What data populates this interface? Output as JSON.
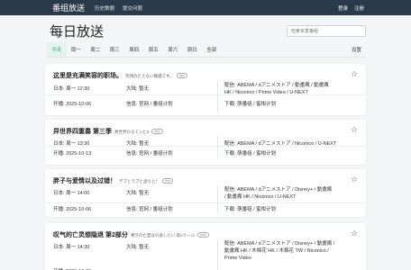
{
  "navbar": {
    "brand": "番组放送",
    "links": [
      "历史数据",
      "提交问题"
    ],
    "login": "登录",
    "register": "注册"
  },
  "page": {
    "title": "每日放送"
  },
  "search": {
    "placeholder": "检索本季番组"
  },
  "tabs": [
    "今天",
    "周一",
    "周二",
    "周三",
    "周四",
    "周五",
    "周六",
    "周日",
    "全部"
  ],
  "active_tab": "今天",
  "settings_label": "设置",
  "labels": {
    "japan": "日本:",
    "mainland": "大陆:",
    "premiere": "开播:",
    "info": "信息:",
    "streaming": "配信:",
    "download": "下载:"
  },
  "cards": [
    {
      "title": "这里是充满笑容的职场。",
      "jp_title": "笑顔のたえない職場です。",
      "badge": "new",
      "japan": "周一 12:30",
      "mainland": "暂无",
      "premiere": "2025-10-06",
      "info": "官网 / 番组计划",
      "streaming": "ABEMA / dアニメストア / 動畫瘋 / 動畫瘋 HK / Niconico / Prime Video / U-NEXT",
      "download": "萌番组 / 蜜柑计划"
    },
    {
      "title": "异世界四重奏 第三季",
      "jp_title": "異世界かるてっと3",
      "badge": "new",
      "japan": "周一 13:30",
      "mainland": "暂无",
      "premiere": "2025-10-13",
      "info": "官网 / 番组计划",
      "streaming": "ABEMA / dアニメストア / Niconico / U-NEXT",
      "download": "萌番组 / 蜜柑计划"
    },
    {
      "title": "胖子与爱情以及过错！",
      "jp_title": "デブとラブと過ちと！",
      "badge": "new",
      "japan": "周一 14:00",
      "mainland": "暂无",
      "premiere": "2025-10-06",
      "info": "官网 / 番组计划",
      "streaming": "ABEMA / dアニメストア / Disney+ / 動畫瘋 / 動畫瘋 HK / Niconico / U-NEXT",
      "download": "萌番组 / 蜜柑计划"
    },
    {
      "title": "叹气的亡灵想隐退 第2部分",
      "jp_title": "嘆きの亡霊は引退したい 第2クール",
      "badge": "new",
      "japan": "周一 14:30",
      "mainland": "暂无",
      "premiere": "2025-10-06",
      "info": "官网 / 番组计划",
      "streaming": "ABEMA / dアニメストア / Disney+ / 動畫瘋 / 動畫瘋 HK / 木棉花 HK / 木棉花 TW / Niconico / Prime Video",
      "download": "萌番组 / 蜜柑计划"
    }
  ]
}
